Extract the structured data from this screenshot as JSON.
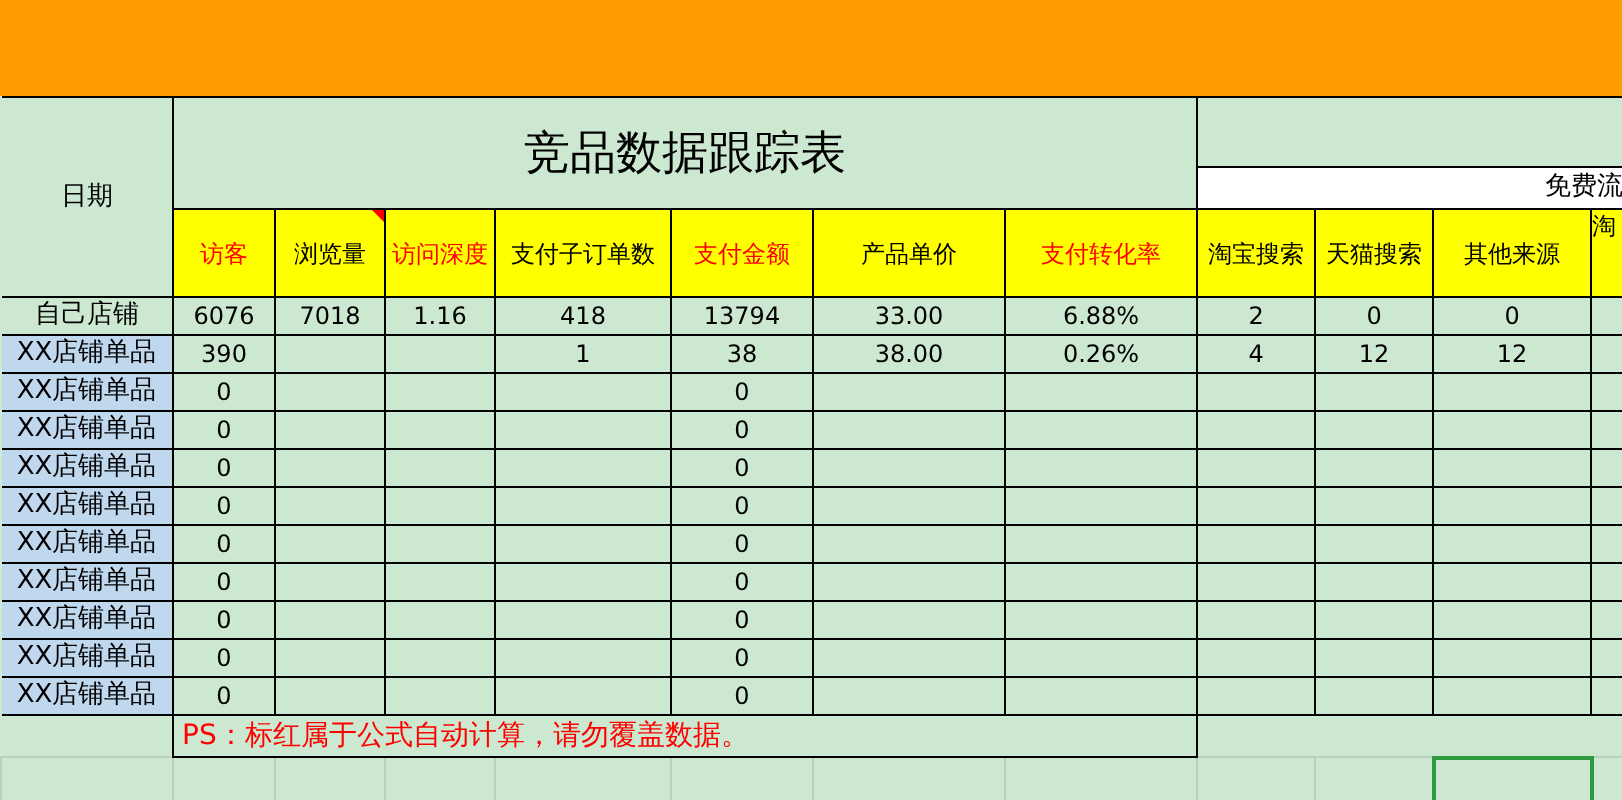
{
  "sheet": {
    "title": "竞品数据跟踪表",
    "date_header": "日期",
    "free_traffic_header": "免费流",
    "columns": [
      {
        "label": "访客",
        "formula": true,
        "comment": false
      },
      {
        "label": "浏览量",
        "formula": false,
        "comment": true
      },
      {
        "label": "访问深度",
        "formula": true,
        "comment": false
      },
      {
        "label": "支付子订单数",
        "formula": false,
        "comment": false
      },
      {
        "label": "支付金额",
        "formula": true,
        "comment": false
      },
      {
        "label": "产品单价",
        "formula": false,
        "comment": false
      },
      {
        "label": "支付转化率",
        "formula": true,
        "comment": false
      },
      {
        "label": "淘宝搜索",
        "formula": false,
        "comment": false
      },
      {
        "label": "天猫搜索",
        "formula": false,
        "comment": false
      },
      {
        "label": "其他来源",
        "formula": false,
        "comment": false
      },
      {
        "label": "淘",
        "formula": false,
        "comment": false
      }
    ],
    "rows": [
      {
        "name": "自己店铺",
        "kind": "own",
        "cells": [
          "6076",
          "7018",
          "1.16",
          "418",
          "13794",
          "33.00",
          "6.88%",
          "2",
          "0",
          "0",
          null
        ]
      },
      {
        "name": "XX店铺单品",
        "kind": "competitor",
        "cells": [
          "390",
          null,
          null,
          "1",
          "38",
          "38.00",
          "0.26%",
          "4",
          "12",
          "12",
          null
        ]
      },
      {
        "name": "XX店铺单品",
        "kind": "competitor",
        "cells": [
          "0",
          null,
          null,
          null,
          "0",
          null,
          null,
          null,
          null,
          null,
          null
        ]
      },
      {
        "name": "XX店铺单品",
        "kind": "competitor",
        "cells": [
          "0",
          null,
          null,
          null,
          "0",
          null,
          null,
          null,
          null,
          null,
          null
        ]
      },
      {
        "name": "XX店铺单品",
        "kind": "competitor",
        "cells": [
          "0",
          null,
          null,
          null,
          "0",
          null,
          null,
          null,
          null,
          null,
          null
        ]
      },
      {
        "name": "XX店铺单品",
        "kind": "competitor",
        "cells": [
          "0",
          null,
          null,
          null,
          "0",
          null,
          null,
          null,
          null,
          null,
          null
        ]
      },
      {
        "name": "XX店铺单品",
        "kind": "competitor",
        "cells": [
          "0",
          null,
          null,
          null,
          "0",
          null,
          null,
          null,
          null,
          null,
          null
        ]
      },
      {
        "name": "XX店铺单品",
        "kind": "competitor",
        "cells": [
          "0",
          null,
          null,
          null,
          "0",
          null,
          null,
          null,
          null,
          null,
          null
        ]
      },
      {
        "name": "XX店铺单品",
        "kind": "competitor",
        "cells": [
          "0",
          null,
          null,
          null,
          "0",
          null,
          null,
          null,
          null,
          null,
          null
        ]
      },
      {
        "name": "XX店铺单品",
        "kind": "competitor",
        "cells": [
          "0",
          null,
          null,
          null,
          "0",
          null,
          null,
          null,
          null,
          null,
          null
        ]
      },
      {
        "name": "XX店铺单品",
        "kind": "competitor",
        "cells": [
          "0",
          null,
          null,
          null,
          "0",
          null,
          null,
          null,
          null,
          null,
          null
        ]
      }
    ],
    "note": "PS：标红属于公式自动计算，请勿覆盖数据。",
    "blank_row": [
      {
        "selected": false
      },
      {
        "selected": false
      },
      {
        "selected": false
      },
      {
        "selected": false
      },
      {
        "selected": false
      },
      {
        "selected": false
      },
      {
        "selected": false
      },
      {
        "selected": false
      },
      {
        "selected": false
      },
      {
        "selected": false
      },
      {
        "selected": true
      },
      {
        "selected": false
      }
    ]
  }
}
